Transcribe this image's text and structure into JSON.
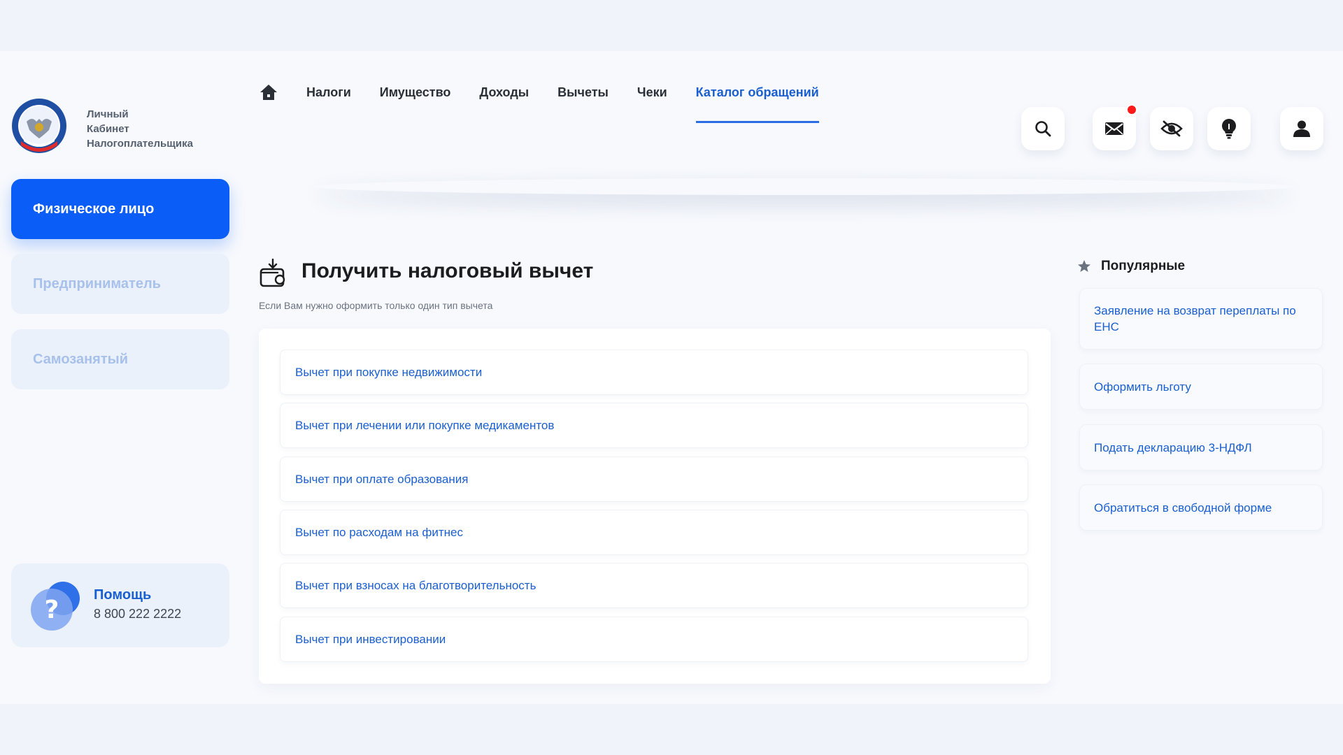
{
  "brand": {
    "line1": "Личный",
    "line2": "Кабинет",
    "line3": "Налогоплательщика",
    "logo_icon": "fns-emblem-icon"
  },
  "nav": {
    "home_icon": "home-icon",
    "tabs": [
      "Налоги",
      "Имущество",
      "Доходы",
      "Вычеты",
      "Чеки",
      "Каталог обращений"
    ],
    "active_tab": "Каталог обращений"
  },
  "header_icons": [
    "search-icon",
    "mail-icon",
    "eye-off-icon",
    "lightbulb-icon",
    "user-icon"
  ],
  "sidebar": {
    "items": [
      "Физическое лицо",
      "Предприниматель",
      "Самозанятый"
    ],
    "active": "Физическое лицо",
    "help": {
      "title": "Помощь",
      "phone": "8 800 222 2222",
      "icon": "question-icon"
    }
  },
  "main": {
    "icon": "wallet-download-icon",
    "title": "Получить налоговый вычет",
    "subtitle": "Если Вам нужно оформить только один тип вычета",
    "items": [
      "Вычет при покупке недвижимости",
      "Вычет при лечении или покупке медикаментов",
      "Вычет при оплате образования",
      "Вычет по расходам на фитнес",
      "Вычет при взносах на благотворительность",
      "Вычет при инвестировании"
    ]
  },
  "popular": {
    "icon": "star-icon",
    "title": "Популярные",
    "items": [
      "Заявление на возврат переплаты по ЕНС",
      "Оформить льготу",
      "Подать декларацию 3-НДФЛ",
      "Обратиться в свободной форме"
    ]
  },
  "colors": {
    "accent": "#0a5ef7",
    "link": "#1a5fd0",
    "notification": "#ff1a1a"
  }
}
